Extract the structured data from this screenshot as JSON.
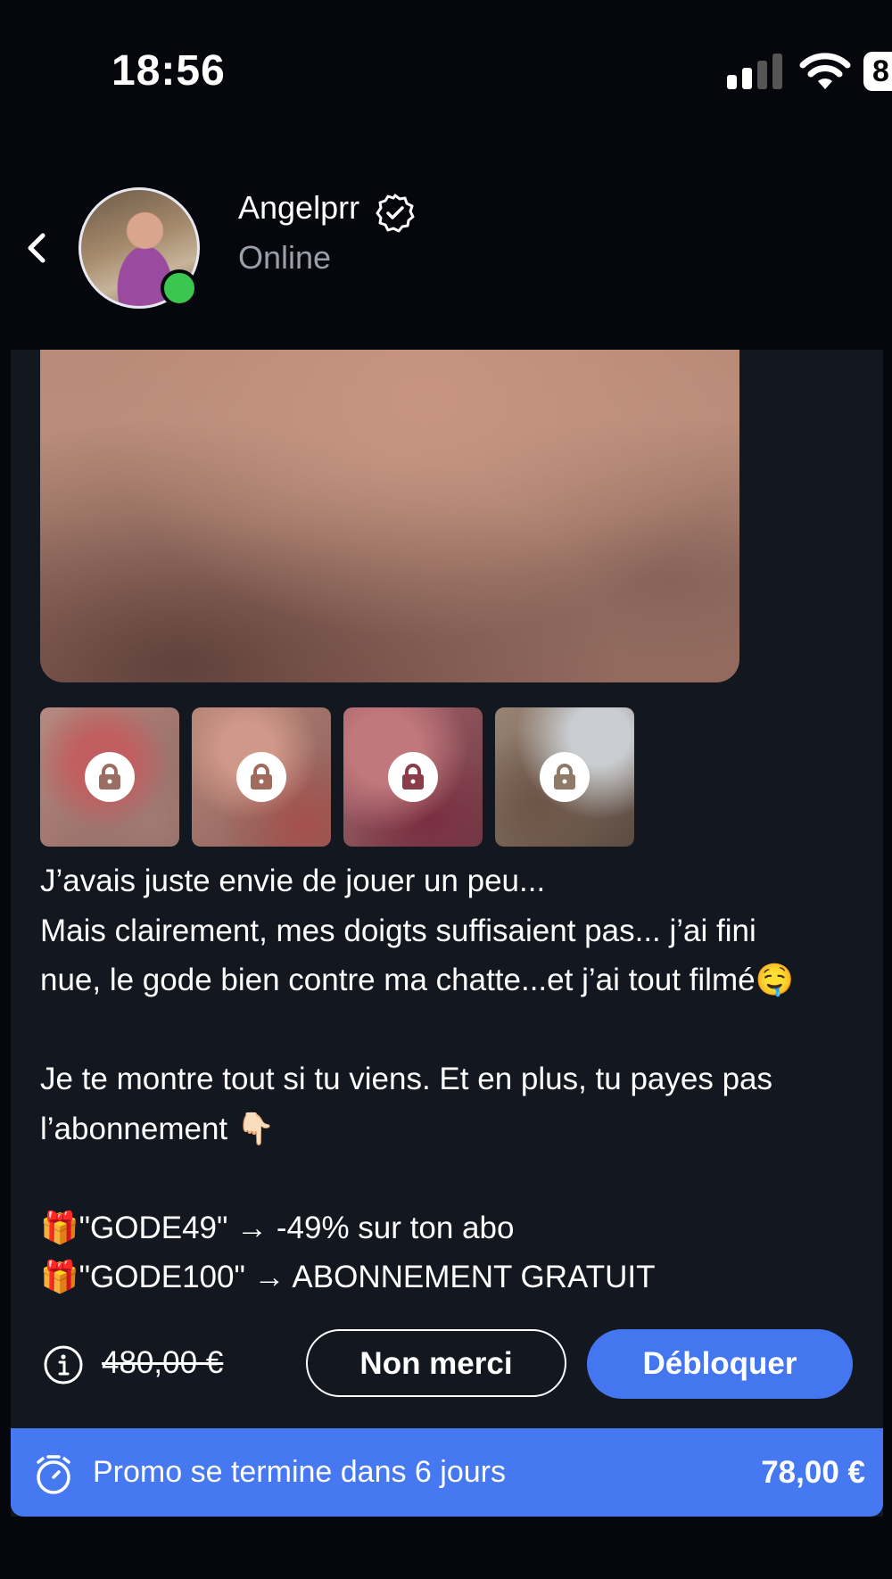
{
  "status_bar": {
    "time": "18:56",
    "battery_text": "8"
  },
  "header": {
    "contact_name": "Angelprr",
    "status": "Online"
  },
  "message": {
    "caption": "J’avais juste envie de jouer un peu...\nMais clairement, mes doigts suffisaient pas... j’ai fini\nnue, le gode bien contre ma chatte...et j’ai tout filmé🤤\n\nJe te montre tout si tu viens. Et en plus, tu payes pas\nl’abonnement 👇🏻\n\n🎁\"GODE49\" → -49% sur ton abo\n🎁\"GODE100\" → ABONNEMENT GRATUIT",
    "locked_thumbnails": 4
  },
  "pricing": {
    "original_price": "480,00 €",
    "decline_label": "Non merci",
    "unlock_label": "Débloquer"
  },
  "promo": {
    "text": "Promo se termine dans 6 jours",
    "price": "78,00 €"
  },
  "colors": {
    "accent": "#4476f0",
    "background": "#05070d",
    "card": "#121720",
    "online": "#3bc74f"
  }
}
